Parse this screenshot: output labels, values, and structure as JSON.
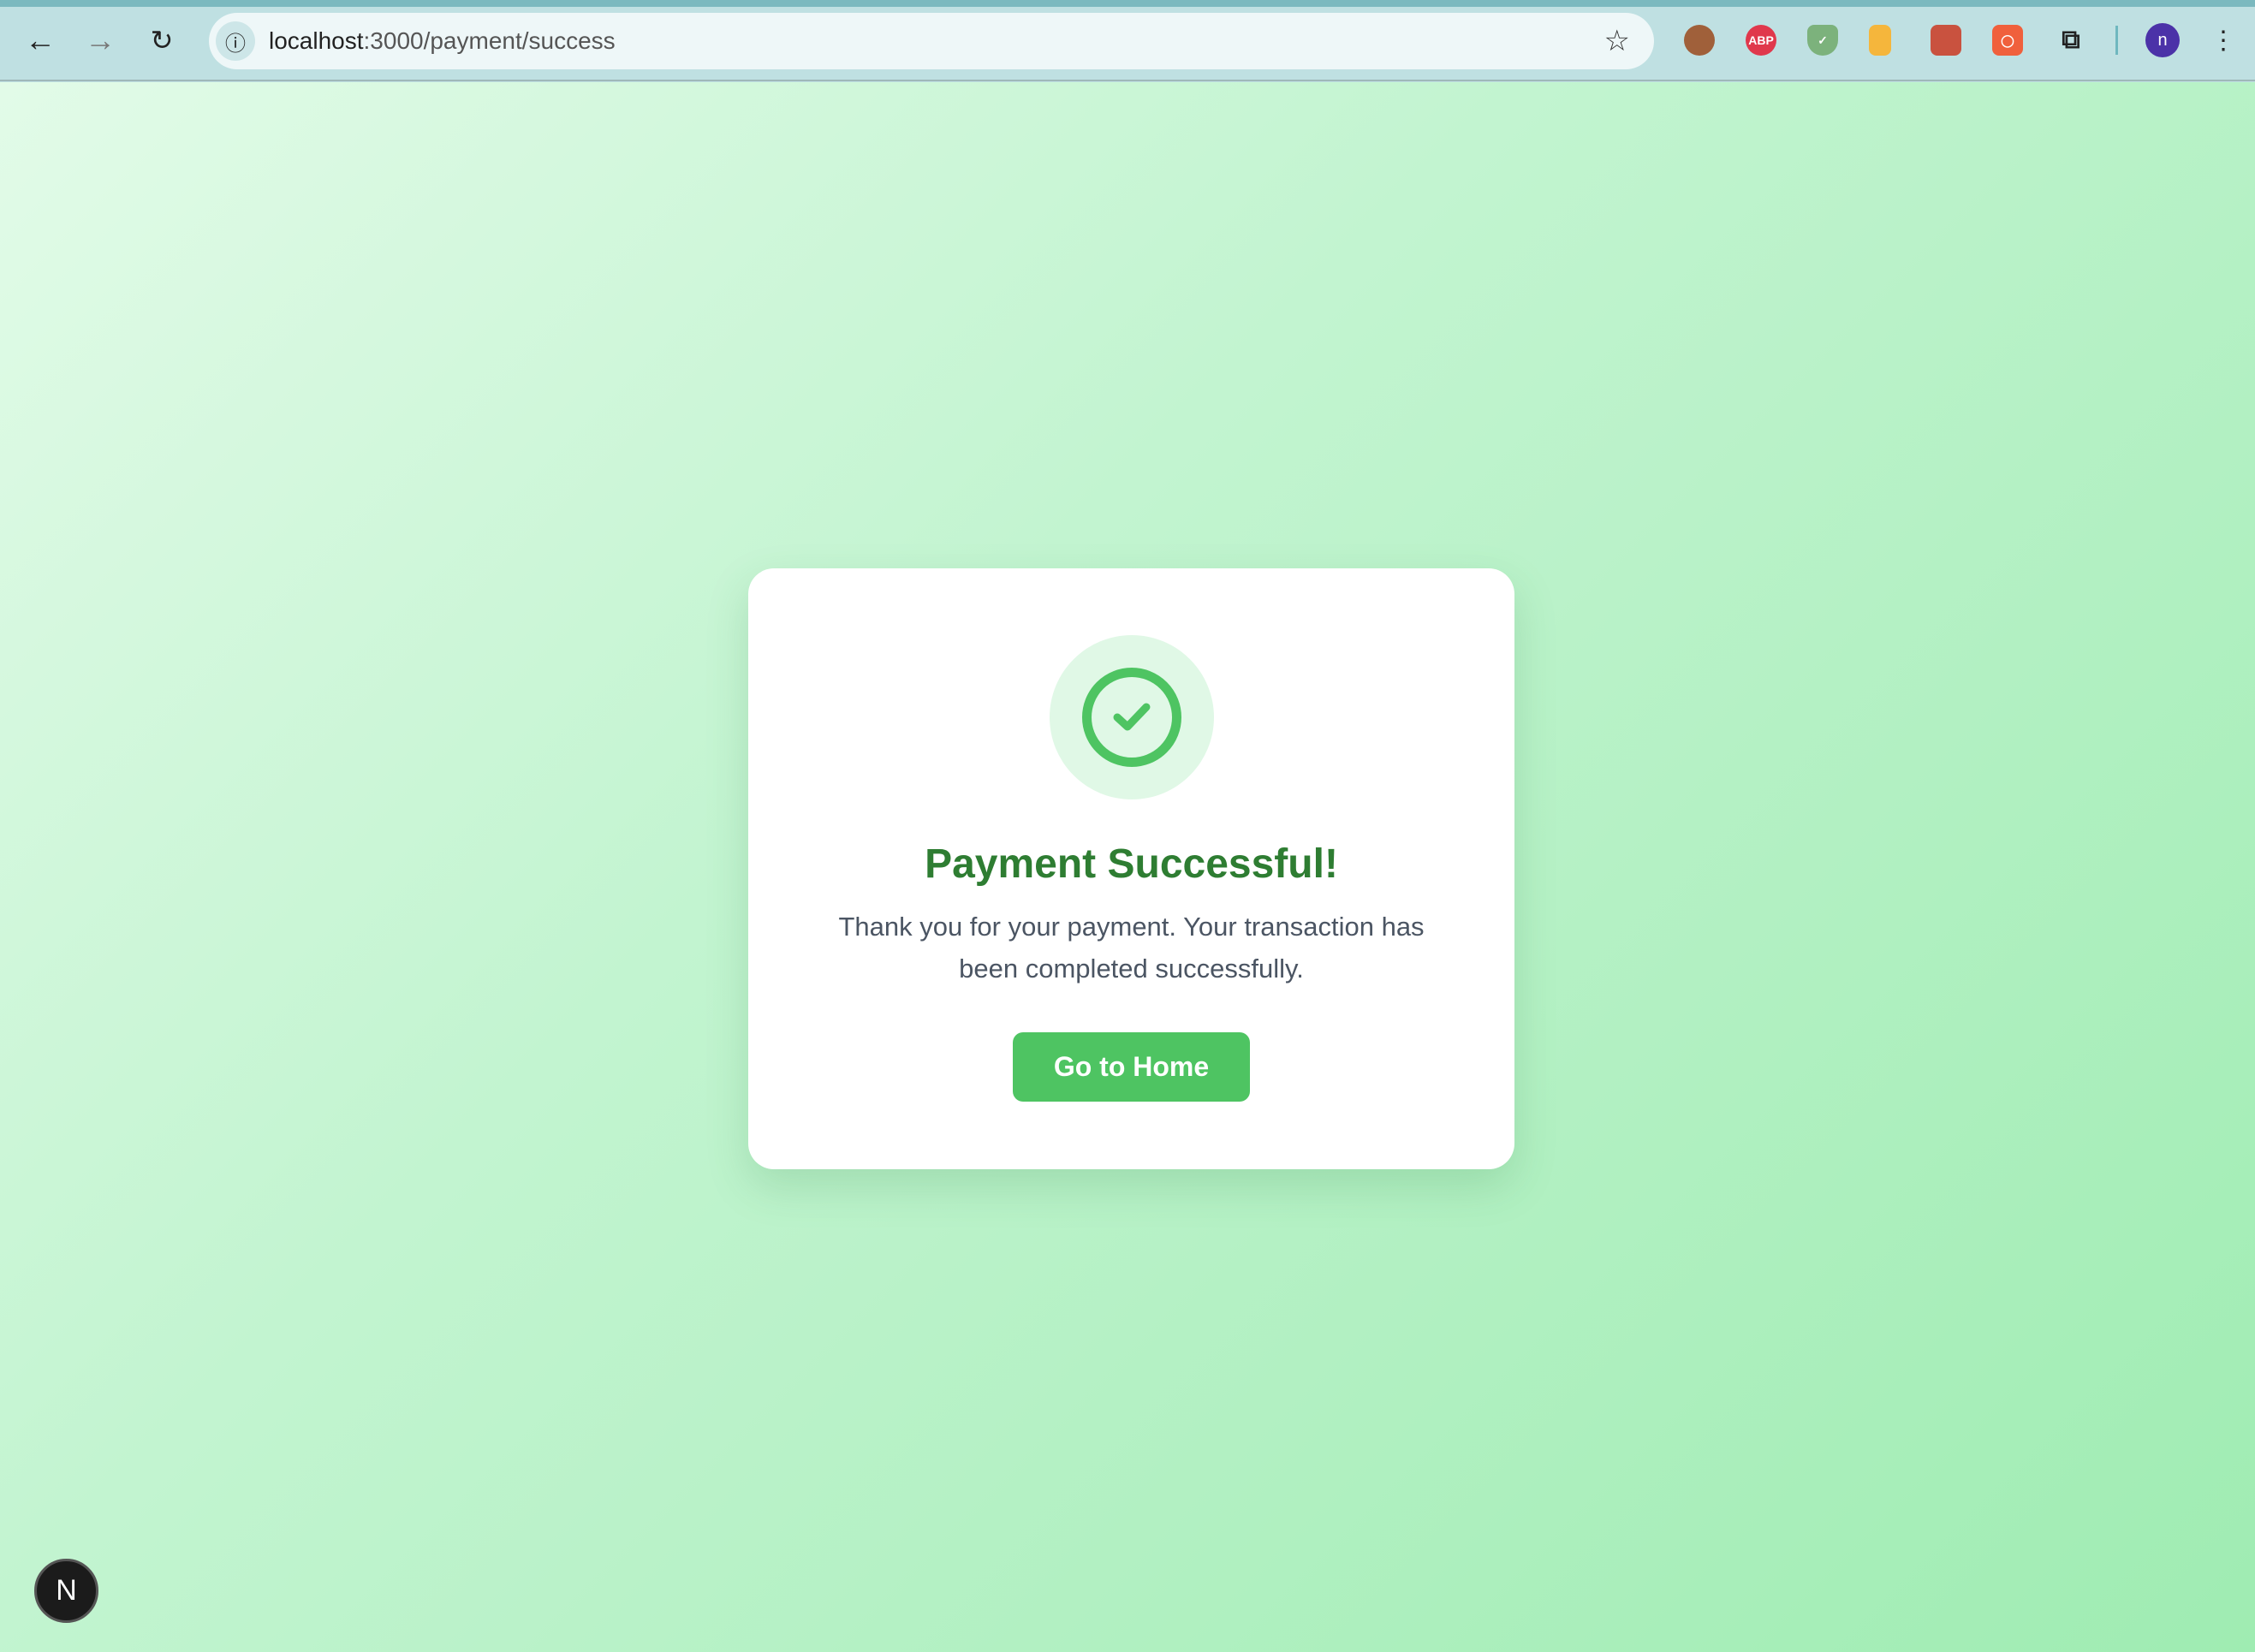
{
  "browser": {
    "url_host": "localhost",
    "url_rest": ":3000/payment/success",
    "profile_initial": "n",
    "extensions": [
      {
        "name": "cookie",
        "color": "#a0603a",
        "label": ""
      },
      {
        "name": "adblock-plus",
        "color": "#e0384c",
        "label": "ABP"
      },
      {
        "name": "shield",
        "color": "#7cb27c",
        "label": ""
      },
      {
        "name": "notes",
        "color": "#f5b63c",
        "label": ""
      },
      {
        "name": "grid-tool",
        "color": "#c9523f",
        "label": ""
      },
      {
        "name": "record",
        "color": "#f0603c",
        "label": ""
      }
    ]
  },
  "card": {
    "title": "Payment Successful!",
    "message": "Thank you for your payment. Your transaction has been completed successfully.",
    "button_label": "Go to Home"
  },
  "dev_badge": "N",
  "colors": {
    "accent": "#4ec462",
    "title": "#2e7d32"
  }
}
